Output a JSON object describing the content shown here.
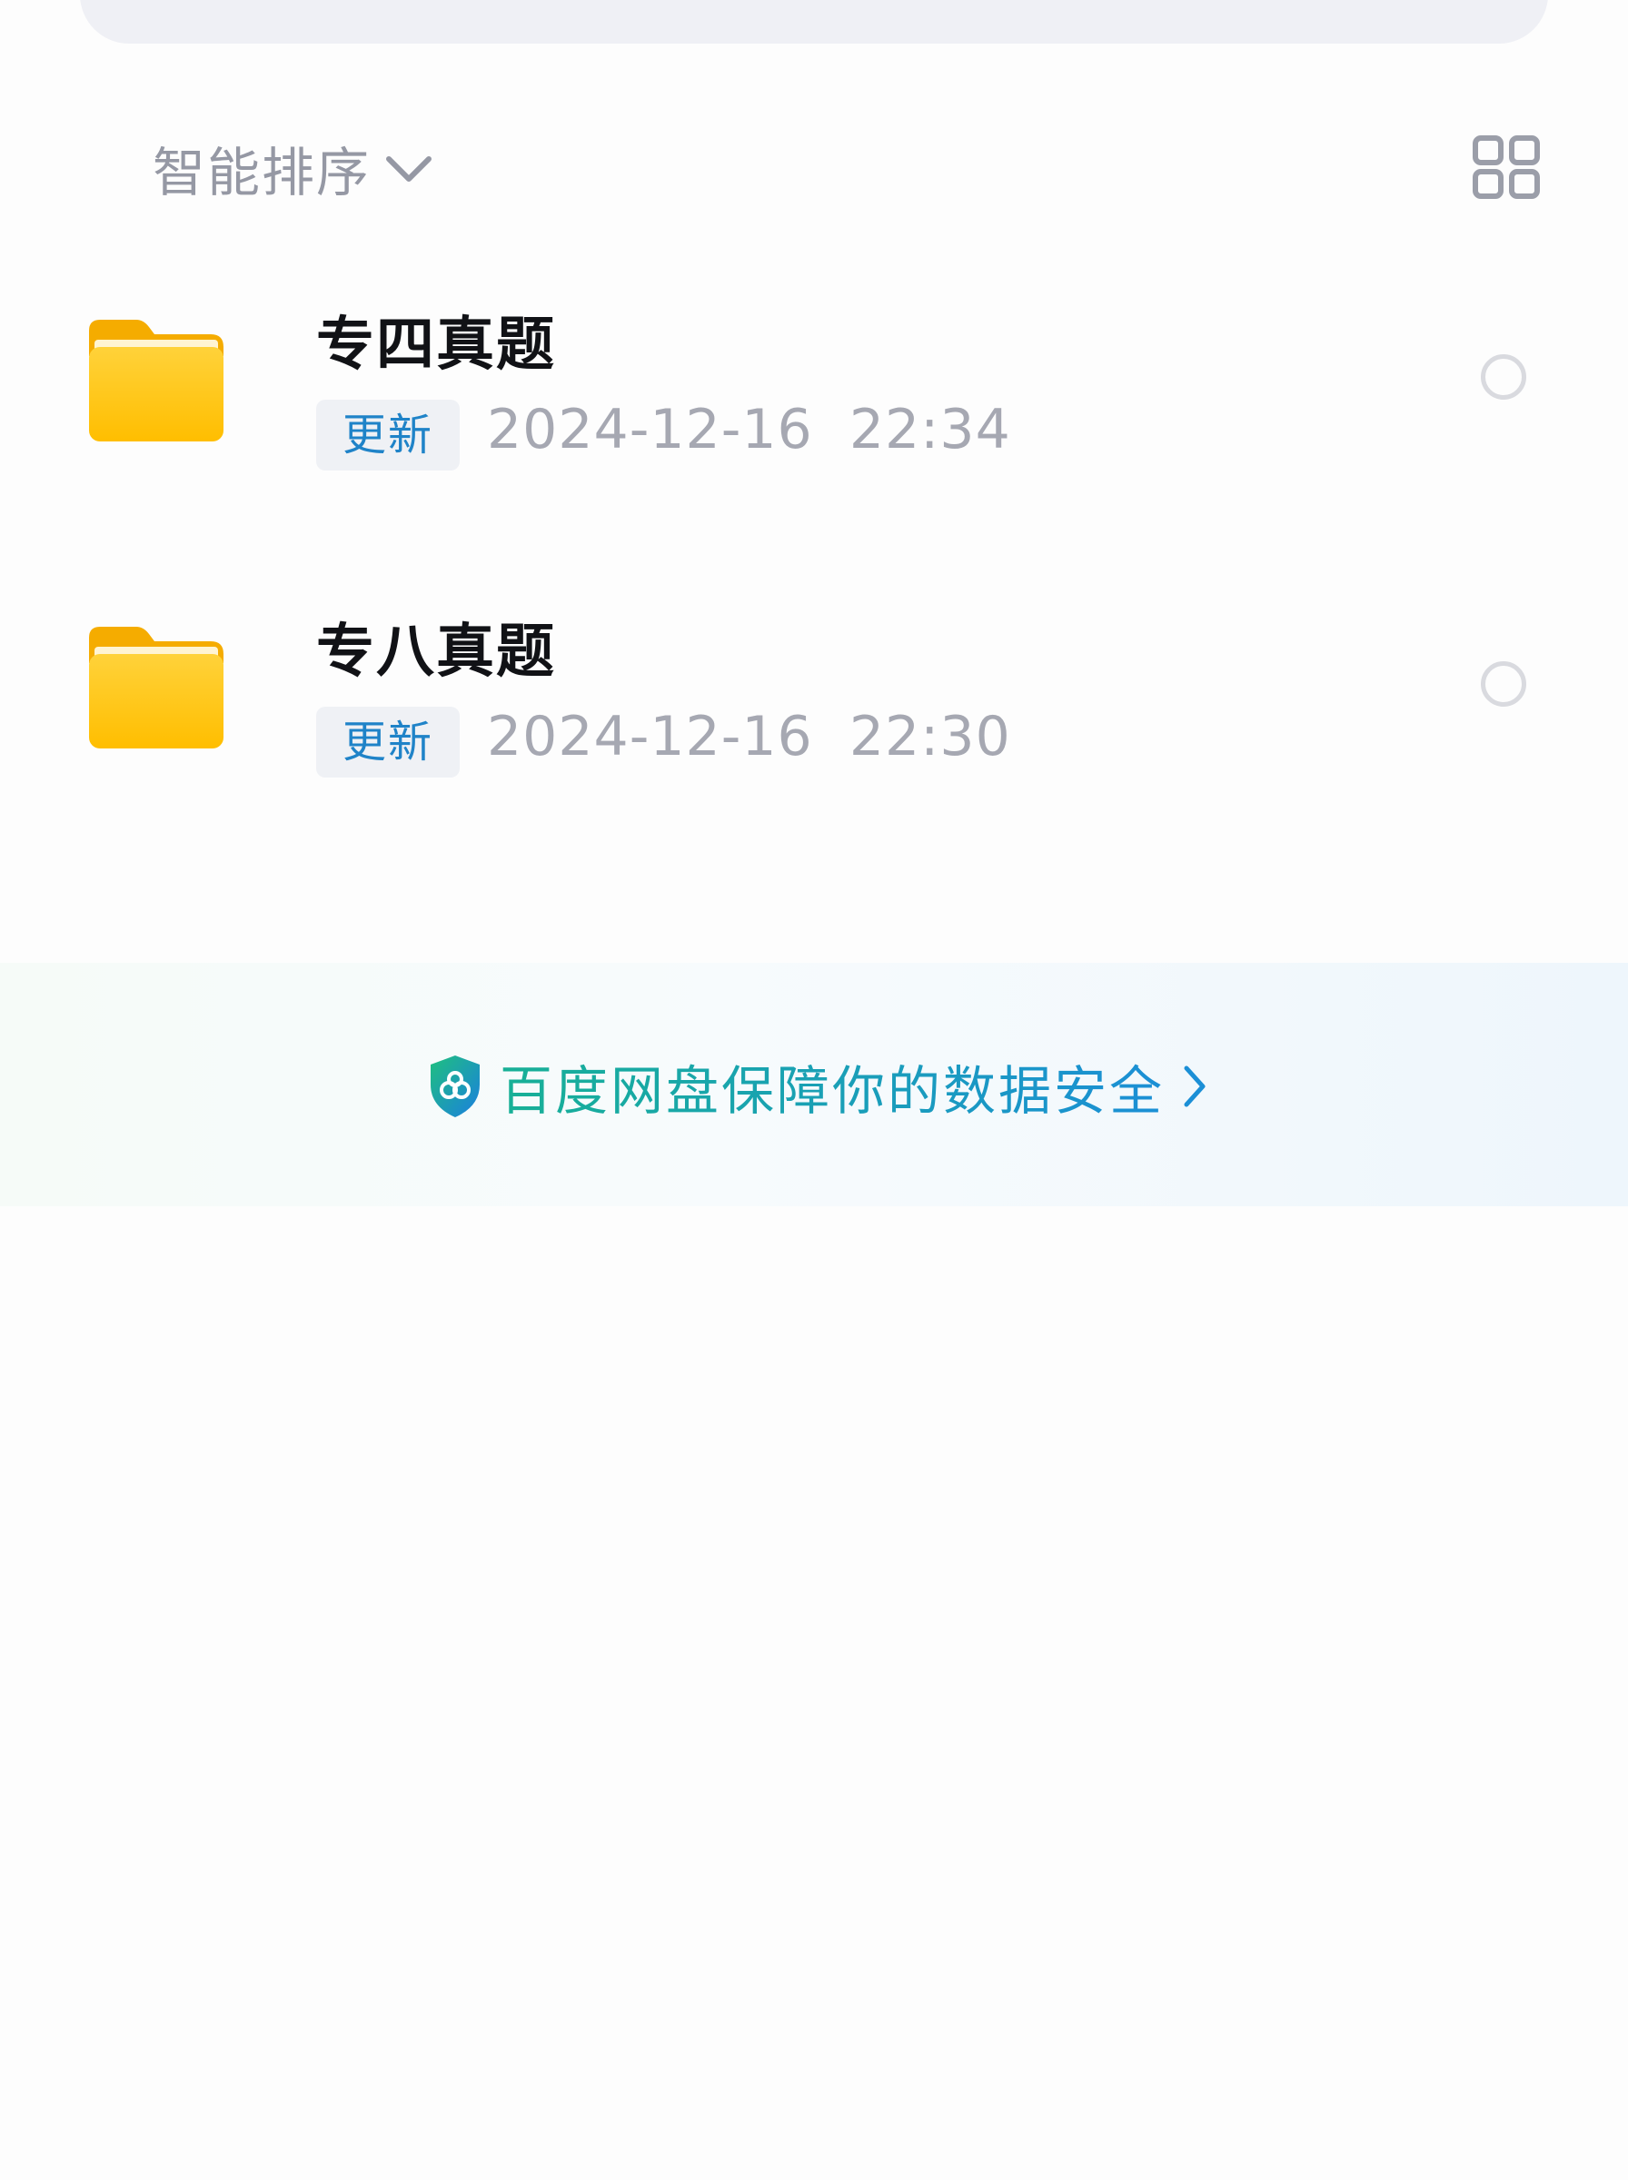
{
  "sort": {
    "label": "智能排序",
    "icon": "chevron-down-icon"
  },
  "view_toggle": {
    "icon": "grid-view-icon"
  },
  "files": [
    {
      "name": "专四真题",
      "badge": "更新",
      "time": "2024-12-16  22:34",
      "icon": "folder-icon"
    },
    {
      "name": "专八真题",
      "badge": "更新",
      "time": "2024-12-16  22:30",
      "icon": "folder-icon"
    }
  ],
  "security": {
    "text": "百度网盘保障你的数据安全",
    "icon": "shield-icon",
    "arrow": "chevron-right-icon"
  },
  "colors": {
    "background": "#fdfdfd",
    "folder": "#ffc20e",
    "badge_text": "#1f83c8",
    "secondary_text": "#a6a8b2",
    "security_gradient_start": "#18b096",
    "security_gradient_end": "#1b8fd6"
  }
}
